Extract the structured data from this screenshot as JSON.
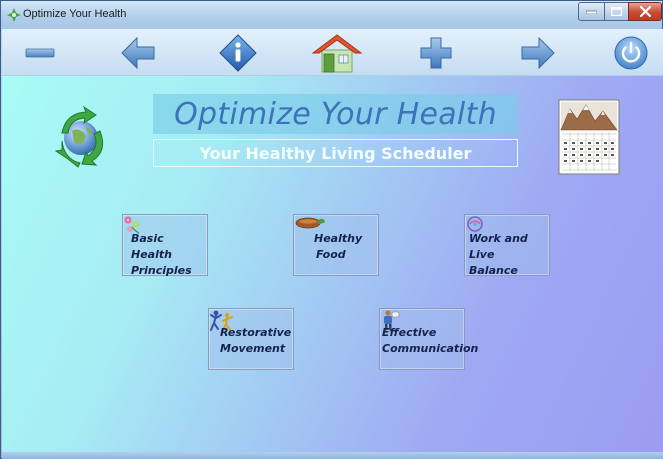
{
  "window": {
    "title": "Optimize Your Health"
  },
  "toolbar": {
    "buttons": [
      {
        "name": "minus",
        "icon": "minus-icon"
      },
      {
        "name": "back",
        "icon": "arrow-left-icon"
      },
      {
        "name": "info",
        "icon": "info-icon"
      },
      {
        "name": "home",
        "icon": "home-icon"
      },
      {
        "name": "add",
        "icon": "plus-icon"
      },
      {
        "name": "forward",
        "icon": "arrow-right-icon"
      },
      {
        "name": "power",
        "icon": "power-icon"
      }
    ]
  },
  "header": {
    "title": "Optimize Your Health",
    "subtitle": "Your Healthy Living Scheduler"
  },
  "tiles": [
    {
      "line1": "Basic Health",
      "line2": "Principles",
      "icon": "flowers-icon"
    },
    {
      "line1": "Healthy",
      "line2": "Food",
      "icon": "food-icon"
    },
    {
      "line1": "Work and Live",
      "line2": "Balance",
      "icon": "balance-icon"
    },
    {
      "line1": "Restorative",
      "line2": "Movement",
      "icon": "exercise-icon"
    },
    {
      "line1": "Effective",
      "line2": "Communication",
      "icon": "communication-icon"
    }
  ],
  "colors": {
    "title_text": "#3f72b8",
    "subtitle_text": "#f4ffff",
    "tile_text": "#14224d"
  }
}
